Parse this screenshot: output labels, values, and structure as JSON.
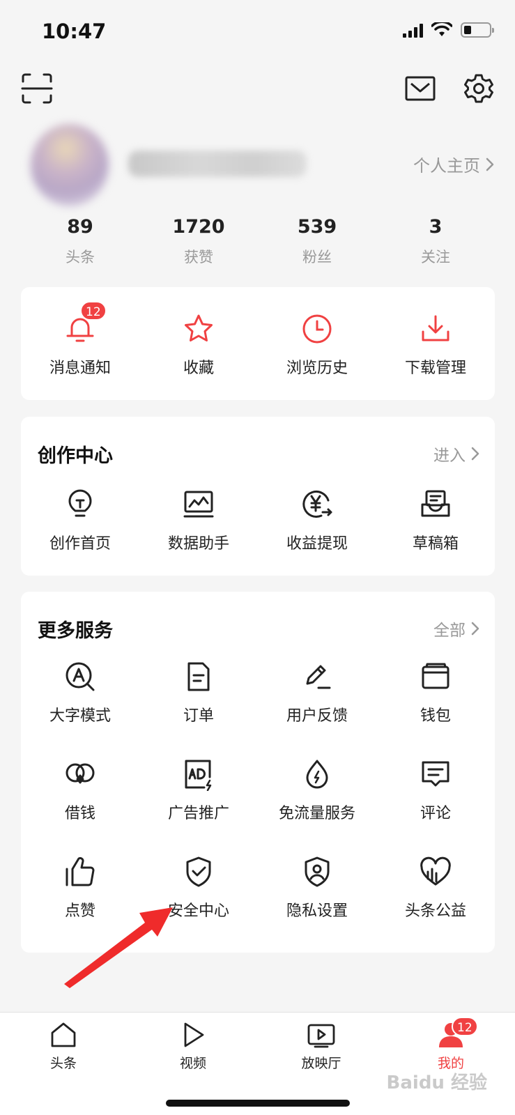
{
  "status_bar": {
    "time": "10:47"
  },
  "profile": {
    "homepage_link": "个人主页"
  },
  "stats": [
    {
      "num": "89",
      "label": "头条"
    },
    {
      "num": "1720",
      "label": "获赞"
    },
    {
      "num": "539",
      "label": "粉丝"
    },
    {
      "num": "3",
      "label": "关注"
    }
  ],
  "quick_actions": [
    {
      "label": "消息通知",
      "icon": "bell-icon",
      "badge": "12"
    },
    {
      "label": "收藏",
      "icon": "star-icon"
    },
    {
      "label": "浏览历史",
      "icon": "clock-icon"
    },
    {
      "label": "下载管理",
      "icon": "download-icon"
    }
  ],
  "creation_center": {
    "title": "创作中心",
    "link": "进入",
    "items": [
      {
        "label": "创作首页",
        "icon": "lightbulb-icon"
      },
      {
        "label": "数据助手",
        "icon": "chart-monitor-icon"
      },
      {
        "label": "收益提现",
        "icon": "yen-coin-icon"
      },
      {
        "label": "草稿箱",
        "icon": "draft-box-icon"
      }
    ]
  },
  "more_services": {
    "title": "更多服务",
    "link": "全部",
    "items": [
      {
        "label": "大字模式",
        "icon": "large-font-icon"
      },
      {
        "label": "订单",
        "icon": "order-icon"
      },
      {
        "label": "用户反馈",
        "icon": "feedback-pen-icon"
      },
      {
        "label": "钱包",
        "icon": "wallet-icon"
      },
      {
        "label": "借钱",
        "icon": "loan-icon"
      },
      {
        "label": "广告推广",
        "icon": "ad-icon"
      },
      {
        "label": "免流量服务",
        "icon": "data-drop-icon"
      },
      {
        "label": "评论",
        "icon": "comment-icon"
      },
      {
        "label": "点赞",
        "icon": "thumbs-up-icon"
      },
      {
        "label": "安全中心",
        "icon": "shield-check-icon"
      },
      {
        "label": "隐私设置",
        "icon": "privacy-shield-icon"
      },
      {
        "label": "头条公益",
        "icon": "charity-heart-icon"
      }
    ]
  },
  "tabbar": {
    "tabs": [
      {
        "label": "头条",
        "icon": "home-icon"
      },
      {
        "label": "视频",
        "icon": "play-icon"
      },
      {
        "label": "放映厅",
        "icon": "tv-play-icon"
      },
      {
        "label": "我的",
        "icon": "user-icon",
        "badge": "12",
        "active": true
      }
    ]
  },
  "watermark": "Baidu 经验",
  "colors": {
    "accent": "#f04142",
    "muted": "#999999",
    "background": "#f5f5f5"
  }
}
